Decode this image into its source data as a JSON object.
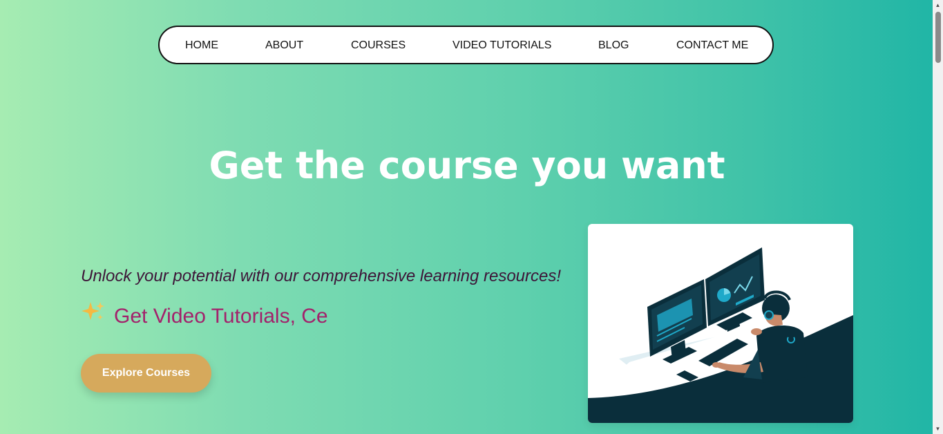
{
  "nav": {
    "items": [
      {
        "label": "HOME"
      },
      {
        "label": "ABOUT"
      },
      {
        "label": "COURSES"
      },
      {
        "label": "VIDEO TUTORIALS"
      },
      {
        "label": "BLOG"
      },
      {
        "label": "CONTACT ME"
      }
    ]
  },
  "hero": {
    "title": "Get the course you want",
    "tagline": "Unlock your potential with our comprehensive learning resources!",
    "typed_text": "Get Video Tutorials, Ce",
    "sparkle_icon": "sparkles-icon",
    "cta_label": "Explore Courses"
  },
  "colors": {
    "gradient_start": "#a6ecb2",
    "gradient_end": "#1fb5a6",
    "cta_bg": "#d6a95c",
    "tagline_color": "#3d1538",
    "typed_color": "#a3216b",
    "illustration_dark": "#0a2e3b",
    "illustration_accent": "#1fa9c9"
  },
  "illustration": {
    "icon": "developer-at-computer-illustration"
  }
}
